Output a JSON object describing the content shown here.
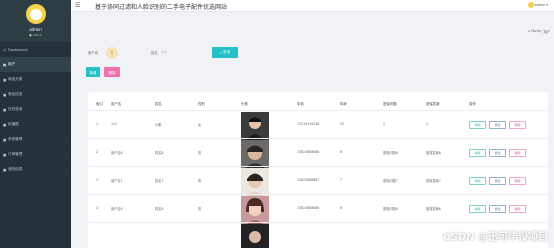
{
  "sidebar": {
    "user_name": "admin",
    "user_status": "● online",
    "items": [
      {
        "label": "Dashboard",
        "icon": "dashboard-icon"
      },
      {
        "label": "用户",
        "icon": "users-icon"
      },
      {
        "label": "商品分类",
        "icon": "category-icon"
      },
      {
        "label": "商品信息",
        "icon": "product-icon"
      },
      {
        "label": "在线咨询",
        "icon": "chat-icon"
      },
      {
        "label": "轮播图",
        "icon": "image-icon"
      },
      {
        "label": "系统管理",
        "icon": "settings-icon"
      },
      {
        "label": "订单管理",
        "icon": "order-icon"
      },
      {
        "label": "我的信息",
        "icon": "profile-icon"
      }
    ]
  },
  "header": {
    "title": "基于协同过滤和人脸识别的二手电子配件优选网站",
    "user": "admin"
  },
  "breadcrumb": {
    "home": "Home",
    "sep": "/",
    "current": "用户"
  },
  "search": {
    "label_1": "用户名",
    "avatar_char": "T",
    "label_2": "姓名",
    "placeholder_2": "姓名",
    "button": "查询"
  },
  "actions": {
    "add": "新增",
    "delete": "删除"
  },
  "table": {
    "headers": [
      "索引",
      "用户名",
      "姓名",
      "性别",
      "头像",
      "手机",
      "年龄",
      "密保问题",
      "密保答案",
      "操作"
    ],
    "rows": [
      {
        "index": "1",
        "username": "111",
        "name": "小刚",
        "gender": "女",
        "phone": "13234516548",
        "age": "22",
        "question": "2",
        "answer": "2"
      },
      {
        "index": "2",
        "username": "用户名8",
        "name": "姓名8",
        "gender": "男",
        "phone": "13823888888",
        "age": "8",
        "question": "密保问题8",
        "answer": "密保答案8"
      },
      {
        "index": "3",
        "username": "用户名7",
        "name": "姓名7",
        "gender": "男",
        "phone": "13823888887",
        "age": "7",
        "question": "密保问题7",
        "answer": "密保答案7"
      },
      {
        "index": "4",
        "username": "用户名6",
        "name": "姓名6",
        "gender": "男",
        "phone": "13823888886",
        "age": "6",
        "question": "密保问题6",
        "answer": "密保答案6"
      }
    ],
    "row_actions": {
      "detail": "详情",
      "edit": "修改",
      "delete": "删除"
    }
  },
  "watermark": "CSDN @迅可毕设项目"
}
